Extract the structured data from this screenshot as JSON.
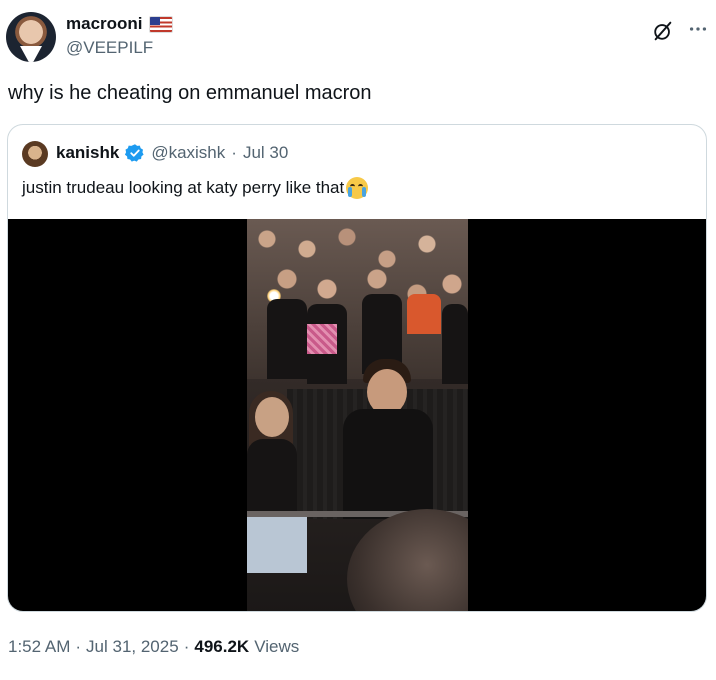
{
  "author": {
    "display_name": "macrooni",
    "flag_icon": "us-flag-icon",
    "handle": "@VEEPILF"
  },
  "tweet": {
    "text": "why is he cheating on emmanuel macron"
  },
  "quoted": {
    "display_name": "kanishk",
    "verified_icon": "verified-badge-icon",
    "handle": "@kaxishk",
    "separator": "·",
    "date": "Jul 30",
    "text": "justin trudeau looking at katy perry like that",
    "emoji": "loudly-crying-face-icon"
  },
  "meta": {
    "time": "1:52 AM",
    "separator1": "·",
    "date": "Jul 31, 2025",
    "separator2": "·",
    "views_count": "496.2K",
    "views_label": "Views"
  },
  "colors": {
    "secondary_text": "#536471",
    "border": "#cfd9de",
    "verified": "#1d9bf0"
  }
}
